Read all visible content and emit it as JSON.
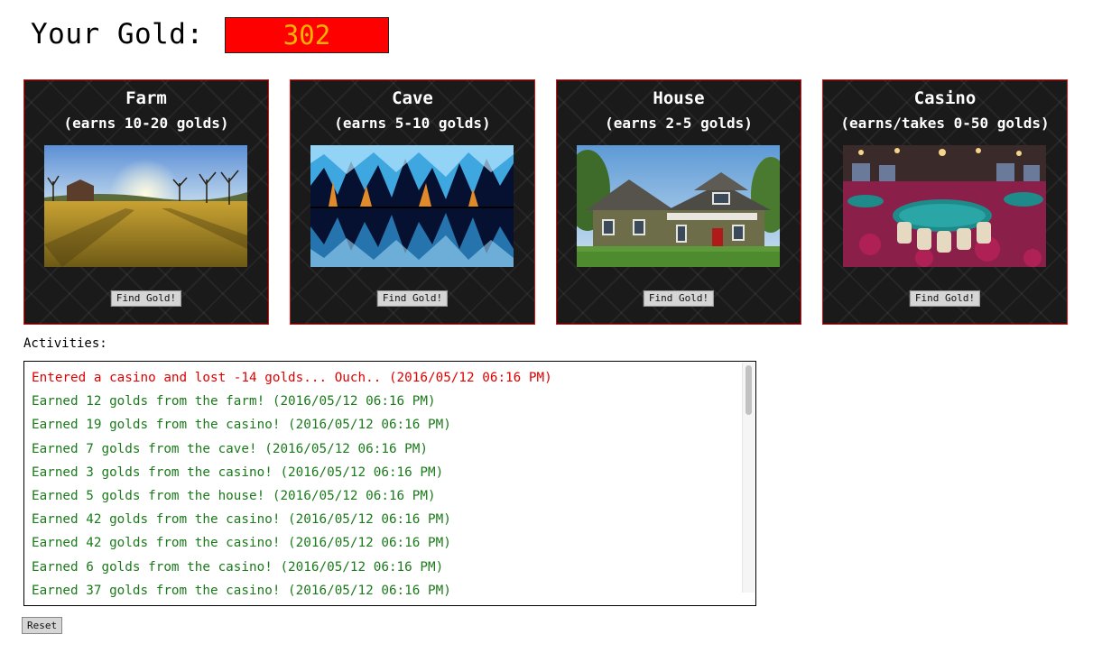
{
  "header": {
    "label": "Your Gold:",
    "gold_value": "302",
    "colors": {
      "box_bg": "#ff0000",
      "value_text": "#ffb300"
    }
  },
  "buildings": [
    {
      "title": "Farm",
      "subtitle": "(earns 10-20 golds)",
      "image": "farm-image",
      "button": "Find Gold!"
    },
    {
      "title": "Cave",
      "subtitle": "(earns 5-10 golds)",
      "image": "cave-image",
      "button": "Find Gold!"
    },
    {
      "title": "House",
      "subtitle": "(earns 2-5 golds)",
      "image": "house-image",
      "button": "Find Gold!"
    },
    {
      "title": "Casino",
      "subtitle": "(earns/takes 0-50 golds)",
      "image": "casino-image",
      "button": "Find Gold!"
    }
  ],
  "activities": {
    "label": "Activities:",
    "entries": [
      {
        "text": "Entered a casino and lost -14 golds... Ouch.. (2016/05/12 06:16 PM)",
        "type": "loss"
      },
      {
        "text": "Earned 12 golds from the farm! (2016/05/12 06:16 PM)",
        "type": "gain"
      },
      {
        "text": "Earned 19 golds from the casino! (2016/05/12 06:16 PM)",
        "type": "gain"
      },
      {
        "text": "Earned 7 golds from the cave! (2016/05/12 06:16 PM)",
        "type": "gain"
      },
      {
        "text": "Earned 3 golds from the casino! (2016/05/12 06:16 PM)",
        "type": "gain"
      },
      {
        "text": "Earned 5 golds from the house! (2016/05/12 06:16 PM)",
        "type": "gain"
      },
      {
        "text": "Earned 42 golds from the casino! (2016/05/12 06:16 PM)",
        "type": "gain"
      },
      {
        "text": "Earned 42 golds from the casino! (2016/05/12 06:16 PM)",
        "type": "gain"
      },
      {
        "text": "Earned 6 golds from the casino! (2016/05/12 06:16 PM)",
        "type": "gain"
      },
      {
        "text": "Earned 37 golds from the casino! (2016/05/12 06:16 PM)",
        "type": "gain"
      }
    ],
    "colors": {
      "loss": "#e00000",
      "gain": "#1b7a1b"
    }
  },
  "reset_label": "Reset"
}
